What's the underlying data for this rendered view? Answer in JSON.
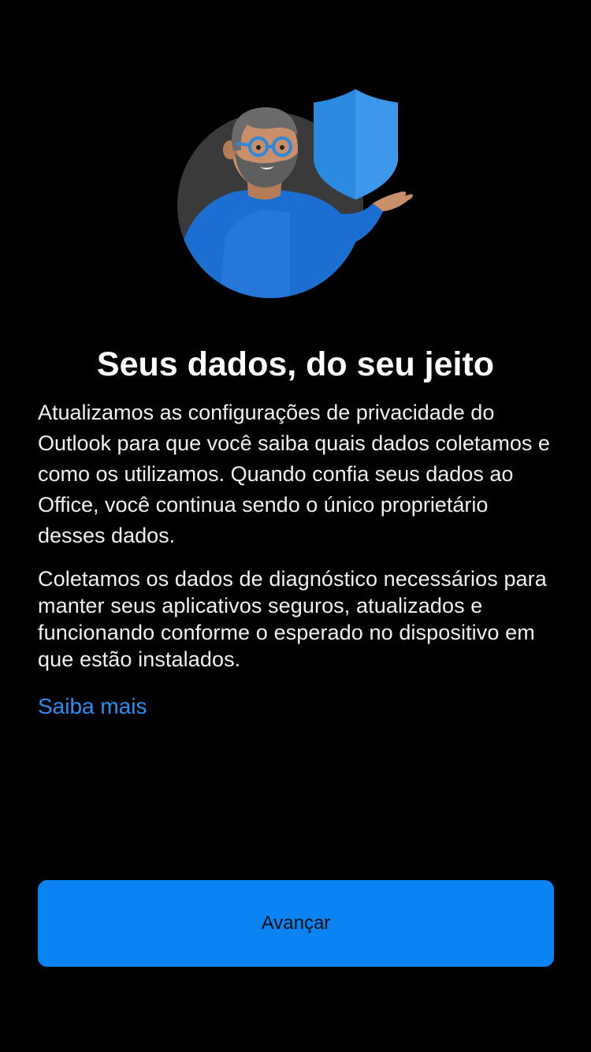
{
  "illustration": {
    "icons": [
      "person-icon",
      "shield-icon"
    ],
    "colors": {
      "circle": "#3a3a3a",
      "shirt": "#1b6fd0",
      "shield": "#2b89e0",
      "skin": "#c98e6a",
      "hair": "#6b6b6b"
    }
  },
  "title": "Seus dados, do seu jeito",
  "paragraphs": {
    "first": "Atualizamos as configurações de privacidade do Outlook para que você saiba quais dados coletamos e como os utilizamos. Quando confia seus dados ao Office, você continua sendo o único proprietário desses dados.",
    "second": "Coletamos os dados de diagnóstico necessários para manter seus aplicativos seguros, atualizados e funcionando conforme o esperado no dispositivo em que estão instalados."
  },
  "learn_more_label": "Saiba mais",
  "next_button_label": "Avançar",
  "colors": {
    "background": "#000000",
    "accent": "#0a84f2",
    "link": "#2b8ef2"
  }
}
